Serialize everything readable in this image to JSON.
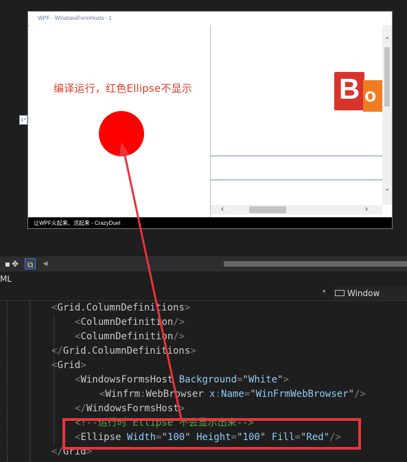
{
  "designer": {
    "window_title": "WPF - WindowsFormHosts - 1",
    "caption": "编译运行，红色Ellipse不显示",
    "footer_text": "让WPF火起来、活起来 - CrazyDuel",
    "row_marker": "1*",
    "logo": {
      "letter_b": "B",
      "letter_o": "o"
    },
    "scroll": {
      "up_icon": "chevron-up-icon",
      "down_icon": "chevron-down-icon",
      "left_icon": "chevron-left-icon",
      "right_icon": "chevron-right-icon"
    },
    "ellipse_color": "#ff0000"
  },
  "toolbar": {
    "icons": [
      "zoom-icon",
      "move-icon",
      "page-icon",
      "scroll-left-icon"
    ]
  },
  "tabs": {
    "xaml_label": "ML"
  },
  "nav": {
    "scope_label": "Window"
  },
  "code": {
    "lines": [
      {
        "indent": 2,
        "tokens": [
          [
            "b",
            "<"
          ],
          [
            "n",
            "Grid.ColumnDefinitions"
          ],
          [
            "b",
            ">"
          ]
        ]
      },
      {
        "indent": 3,
        "tokens": [
          [
            "b",
            "<"
          ],
          [
            "n",
            "ColumnDefinition"
          ],
          [
            "b",
            "/>"
          ]
        ]
      },
      {
        "indent": 3,
        "tokens": [
          [
            "b",
            "<"
          ],
          [
            "n",
            "ColumnDefinition"
          ],
          [
            "b",
            "/>"
          ]
        ]
      },
      {
        "indent": 2,
        "tokens": [
          [
            "b",
            "</"
          ],
          [
            "n",
            "Grid.ColumnDefinitions"
          ],
          [
            "b",
            ">"
          ]
        ]
      },
      {
        "indent": 2,
        "tokens": [
          [
            "b",
            "<"
          ],
          [
            "n",
            "Grid"
          ],
          [
            "b",
            ">"
          ]
        ]
      },
      {
        "indent": 3,
        "tokens": [
          [
            "b",
            "<"
          ],
          [
            "n",
            "WindowsFormsHost"
          ],
          [
            "a",
            " Background"
          ],
          [
            "b",
            "="
          ],
          [
            "q",
            "\""
          ],
          [
            "a",
            "White"
          ],
          [
            "q",
            "\""
          ],
          [
            "b",
            ">"
          ]
        ]
      },
      {
        "indent": 4,
        "tokens": [
          [
            "b",
            "<"
          ],
          [
            "n",
            "Winfrm"
          ],
          [
            "b",
            ":"
          ],
          [
            "n",
            "WebBrowser"
          ],
          [
            "a",
            " x"
          ],
          [
            "b",
            ":"
          ],
          [
            "a",
            "Name"
          ],
          [
            "b",
            "="
          ],
          [
            "q",
            "\""
          ],
          [
            "a",
            "WinFrmWebBrowser"
          ],
          [
            "q",
            "\""
          ],
          [
            "b",
            "/>"
          ]
        ]
      },
      {
        "indent": 3,
        "tokens": [
          [
            "b",
            "</"
          ],
          [
            "n",
            "WindowsFormsHost"
          ],
          [
            "b",
            ">"
          ]
        ]
      },
      {
        "indent": 3,
        "tokens": [
          [
            "c",
            "<!--运行时 Ellipse 不会显示出来-->"
          ]
        ]
      },
      {
        "indent": 3,
        "tokens": [
          [
            "b",
            "<"
          ],
          [
            "n",
            "Ellipse"
          ],
          [
            "a",
            " Width"
          ],
          [
            "b",
            "="
          ],
          [
            "q",
            "\""
          ],
          [
            "a",
            "100"
          ],
          [
            "q",
            "\""
          ],
          [
            "a",
            " Height"
          ],
          [
            "b",
            "="
          ],
          [
            "q",
            "\""
          ],
          [
            "a",
            "100"
          ],
          [
            "q",
            "\""
          ],
          [
            "a",
            " Fill"
          ],
          [
            "b",
            "="
          ],
          [
            "q",
            "\""
          ],
          [
            "a",
            "Red"
          ],
          [
            "q",
            "\""
          ],
          [
            "b",
            "/>"
          ]
        ]
      },
      {
        "indent": 2,
        "tokens": [
          [
            "b",
            "</"
          ],
          [
            "n",
            "Grid"
          ],
          [
            "b",
            ">"
          ]
        ]
      }
    ]
  },
  "annotation": {
    "color": "#e8343c"
  }
}
